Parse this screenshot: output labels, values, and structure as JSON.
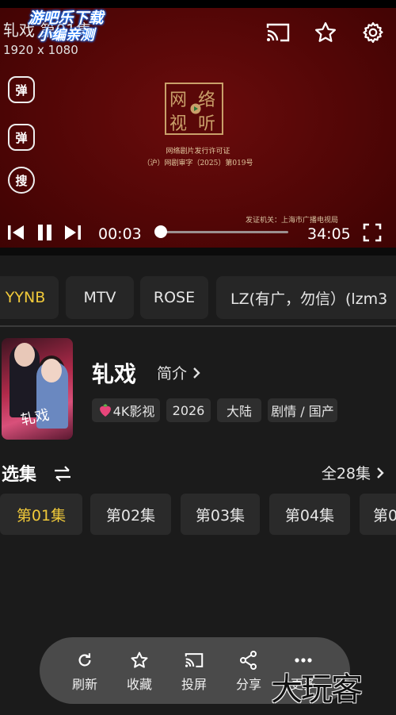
{
  "player": {
    "title": "轧戏   第01集",
    "resolution": "1920 x 1080",
    "current_time": "00:03",
    "total_time": "34:05",
    "progress_fraction": 0.02,
    "watermark_line1": "游吧乐下载",
    "watermark_line2": "小编亲测",
    "side_buttons": [
      "弹",
      "弹",
      "搜"
    ],
    "license_logo_chars": [
      "网",
      "络",
      "视",
      "听"
    ],
    "license_line1": "网络剧片发行许可证",
    "license_line2": "（沪）网剧审字（2025）第019号",
    "issuer": "发证机关：上海市广播电视局",
    "icons": [
      "cast-icon",
      "star-icon",
      "gear-icon",
      "skip-previous-icon",
      "pause-icon",
      "skip-next-icon",
      "fullscreen-icon"
    ]
  },
  "sources": [
    {
      "label": "YYNB",
      "active": true
    },
    {
      "label": "MTV",
      "active": false
    },
    {
      "label": "ROSE",
      "active": false
    },
    {
      "label": "LZ(有广，勿信）(lzm3",
      "active": false
    }
  ],
  "show": {
    "title": "轧戏",
    "intro_label": "简介",
    "poster_title": "轧戏",
    "tags": [
      "4K影视",
      "2026",
      "大陆",
      "剧情 / 国产"
    ]
  },
  "episodes_header": {
    "title": "选集",
    "total": "全28集"
  },
  "episodes": [
    {
      "label": "第01集",
      "active": true
    },
    {
      "label": "第02集",
      "active": false
    },
    {
      "label": "第03集",
      "active": false
    },
    {
      "label": "第04集",
      "active": false
    },
    {
      "label": "第0",
      "active": false
    }
  ],
  "toolbar": {
    "refresh": "刷新",
    "favorite": "收藏",
    "cast": "投屏",
    "share": "分享",
    "more": "更多"
  },
  "brand_watermark": "大玩客",
  "colors": {
    "player_bg": "#520606",
    "accent": "#f0c93a",
    "page_bg": "#1b1b1b",
    "chip_bg": "#262626",
    "toolbar_bg": "#4a4a4a"
  }
}
